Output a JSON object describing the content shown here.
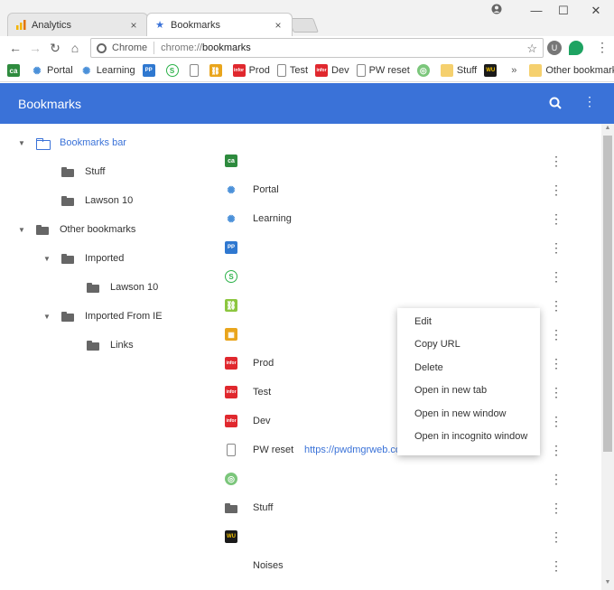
{
  "browser": {
    "tabs": [
      {
        "label": "Analytics",
        "close": "×"
      },
      {
        "label": "Bookmarks",
        "close": "×"
      }
    ],
    "window_controls": {
      "minimize": "—",
      "maximize": "☐",
      "close": "✕"
    },
    "toolbar": {
      "scheme": "Chrome",
      "url_prefix": "chrome://",
      "url_host": "bookmarks"
    },
    "bookmarks_bar": [
      {
        "label": "",
        "icon": "ca-icon"
      },
      {
        "label": "Portal",
        "icon": "wave-icon"
      },
      {
        "label": "Learning",
        "icon": "wave-icon"
      },
      {
        "label": "",
        "icon": "pp-icon"
      },
      {
        "label": "",
        "icon": "s-icon"
      },
      {
        "label": "",
        "icon": "page-icon"
      },
      {
        "label": "",
        "icon": "link-icon"
      },
      {
        "label": "Prod",
        "icon": "infor-icon"
      },
      {
        "label": "Test",
        "icon": "page-icon"
      },
      {
        "label": "Dev",
        "icon": "infor-icon"
      },
      {
        "label": "PW reset",
        "icon": "page-icon"
      },
      {
        "label": "",
        "icon": "globe-icon"
      },
      {
        "label": "Stuff",
        "icon": "folder-icon"
      },
      {
        "label": "",
        "icon": "wu-icon"
      }
    ],
    "overflow": "»",
    "other_bookmarks": "Other bookmarks"
  },
  "app": {
    "title": "Bookmarks",
    "menu": "⋮"
  },
  "tree": [
    {
      "label": "Bookmarks bar",
      "arrow": "▼"
    },
    {
      "label": "Stuff",
      "arrow": ""
    },
    {
      "label": "Lawson 10",
      "arrow": ""
    },
    {
      "label": "Other bookmarks",
      "arrow": "▼"
    },
    {
      "label": "Imported",
      "arrow": "▼"
    },
    {
      "label": "Lawson 10",
      "arrow": ""
    },
    {
      "label": "Imported From IE",
      "arrow": "▼"
    },
    {
      "label": "Links",
      "arrow": ""
    }
  ],
  "list": [
    {
      "title": "",
      "url": "",
      "icon": "CA"
    },
    {
      "title": "Portal",
      "url": "",
      "icon": "wave"
    },
    {
      "title": "Learning",
      "url": "",
      "icon": "wave"
    },
    {
      "title": "",
      "url": "",
      "icon": "PP"
    },
    {
      "title": "",
      "url": "",
      "icon": "S"
    },
    {
      "title": "",
      "url": "",
      "icon": "link"
    },
    {
      "title": "",
      "url": "",
      "icon": "orange"
    },
    {
      "title": "Prod",
      "url": "",
      "icon": "infor"
    },
    {
      "title": "Test",
      "url": "",
      "icon": "infor"
    },
    {
      "title": "Dev",
      "url": "",
      "icon": "infor"
    },
    {
      "title": "PW reset",
      "url": "https://pwdmgrweb.co",
      "icon": "page"
    },
    {
      "title": "",
      "url": "",
      "icon": "globe"
    },
    {
      "title": "Stuff",
      "url": "",
      "icon": "folder"
    },
    {
      "title": "",
      "url": "",
      "icon": "WU"
    },
    {
      "title": "Noises",
      "url": "",
      "icon": "blank"
    }
  ],
  "row_menu": "⋮",
  "context_menu": [
    "Edit",
    "Copy URL",
    "Delete",
    "Open in new tab",
    "Open in new window",
    "Open in incognito window"
  ],
  "colors": {
    "accent": "#3a72d8",
    "infor_red": "#e0282e",
    "ca_green": "#2e8b3e"
  }
}
